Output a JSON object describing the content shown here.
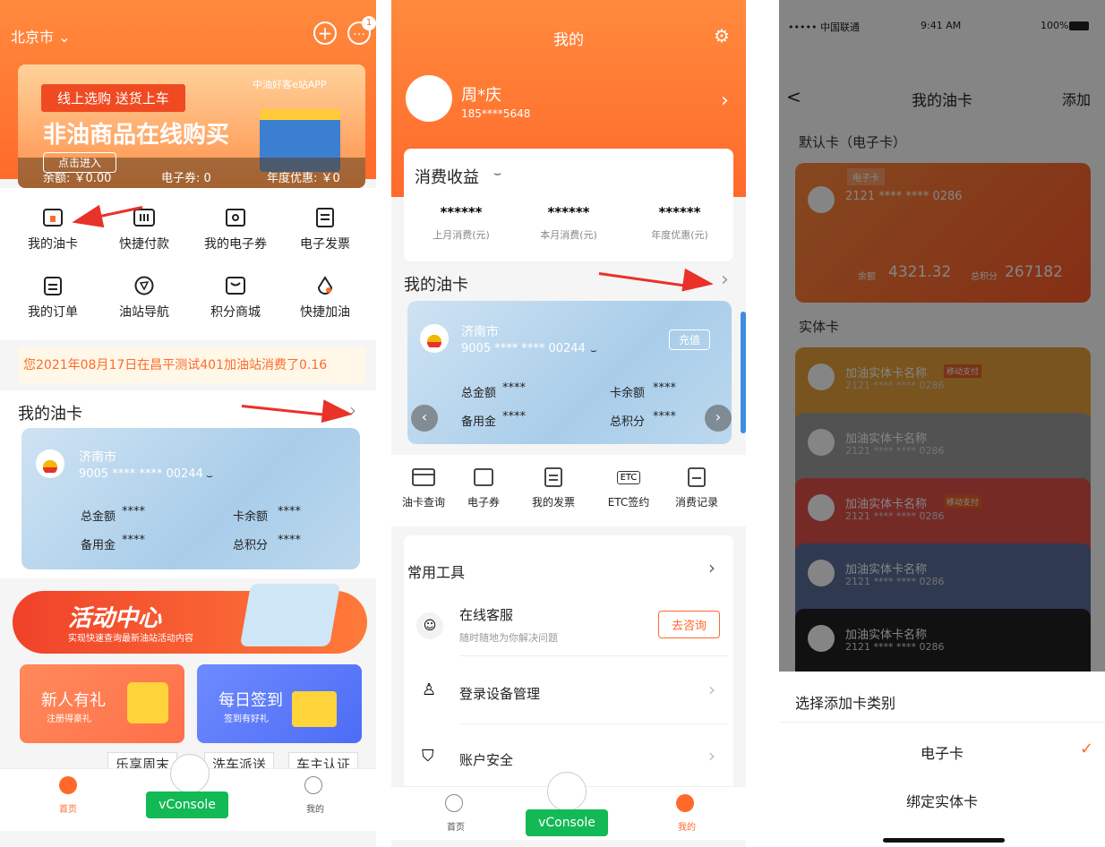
{
  "p1": {
    "city": "北京市",
    "banner": {
      "tag": "线上选购 送货上车",
      "title": "非油商品在线购买",
      "app": "中油好客e站APP",
      "enter": "点击进入",
      "balance": "余额: ￥0.00",
      "coupon": "电子券: 0",
      "discount": "年度优惠: ￥0"
    },
    "icons": [
      "我的油卡",
      "快捷付款",
      "我的电子券",
      "电子发票",
      "我的订单",
      "油站导航",
      "积分商城",
      "快捷加油"
    ],
    "notice": "您2021年08月17日在昌平测试401加油站消费了0.16",
    "section": "我的油卡",
    "card": {
      "city": "济南市",
      "number": "9005 **** **** 00244",
      "total_l": "总金额",
      "total": "****",
      "bal_l": "卡余额",
      "bal": "****",
      "reserve_l": "备用金",
      "reserve": "****",
      "points_l": "总积分",
      "points": "****"
    },
    "activity": {
      "title": "活动中心",
      "sub": "实现快速查询最新油站活动内容"
    },
    "promo1": {
      "title": "新人有礼",
      "sub": "注册得豪礼"
    },
    "promo2": {
      "title": "每日签到",
      "sub": "签到有好礼"
    },
    "strip": [
      "乐享周末",
      "洗车派送",
      "车主认证"
    ],
    "tabs": {
      "home": "首页",
      "mine": "我的"
    },
    "vconsole": "vConsole",
    "badge": "1"
  },
  "p2": {
    "title": "我的",
    "user": {
      "name": "周*庆",
      "phone": "185****5648"
    },
    "earnings": {
      "title": "消费收益",
      "items": [
        {
          "v": "******",
          "l": "上月消费(元)"
        },
        {
          "v": "******",
          "l": "本月消费(元)"
        },
        {
          "v": "******",
          "l": "年度优惠(元)"
        }
      ]
    },
    "section": "我的油卡",
    "card": {
      "city": "济南市",
      "number": "9005 **** **** 00244",
      "recharge": "充值",
      "total_l": "总金额",
      "total": "****",
      "bal_l": "卡余额",
      "bal": "****",
      "reserve_l": "备用金",
      "reserve": "****",
      "points_l": "总积分",
      "points": "****"
    },
    "quick": [
      "油卡查询",
      "电子券",
      "我的发票",
      "ETC签约",
      "消费记录"
    ],
    "tools": {
      "title": "常用工具",
      "service": "在线客服",
      "service_sub": "随时随地为你解决问题",
      "consult": "去咨询",
      "device": "登录设备管理",
      "security": "账户安全"
    },
    "tabs": {
      "home": "首页",
      "mine": "我的"
    },
    "vconsole": "vConsole",
    "etc": "ETC"
  },
  "p3": {
    "status": {
      "carrier": "••••• 中国联通",
      "time": "9:41 AM",
      "battery": "100%"
    },
    "nav": {
      "back": "<",
      "title": "我的油卡",
      "add": "添加"
    },
    "default_label": "默认卡（电子卡）",
    "ecard": {
      "tag": "电子卡",
      "number": "2121 **** **** 0286",
      "bal_l": "余额",
      "bal": "4321.32",
      "pts_l": "总积分",
      "pts": "267182"
    },
    "phys_label": "实体卡",
    "phys": [
      {
        "name": "加油实体卡名称",
        "no": "2121 **** **** 0286",
        "tag": "移动支付",
        "color": "#e8a23a"
      },
      {
        "name": "加油实体卡名称",
        "no": "2121 **** **** 0286",
        "tag": "",
        "color": "#9e9e9e"
      },
      {
        "name": "加油实体卡名称",
        "no": "2121 **** **** 0286",
        "tag": "移动支付",
        "color": "#e0514a"
      },
      {
        "name": "加油实体卡名称",
        "no": "2121 **** **** 0286",
        "tag": "",
        "color": "#5b6d99"
      },
      {
        "name": "加油实体卡名称",
        "no": "2121 **** **** 0286",
        "tag": "",
        "color": "#222222"
      }
    ],
    "sheet": {
      "title": "选择添加卡类别",
      "opt1": "电子卡",
      "opt2": "绑定实体卡"
    }
  },
  "colors": {
    "orange": "#ff6a2b",
    "green": "#13b955"
  }
}
